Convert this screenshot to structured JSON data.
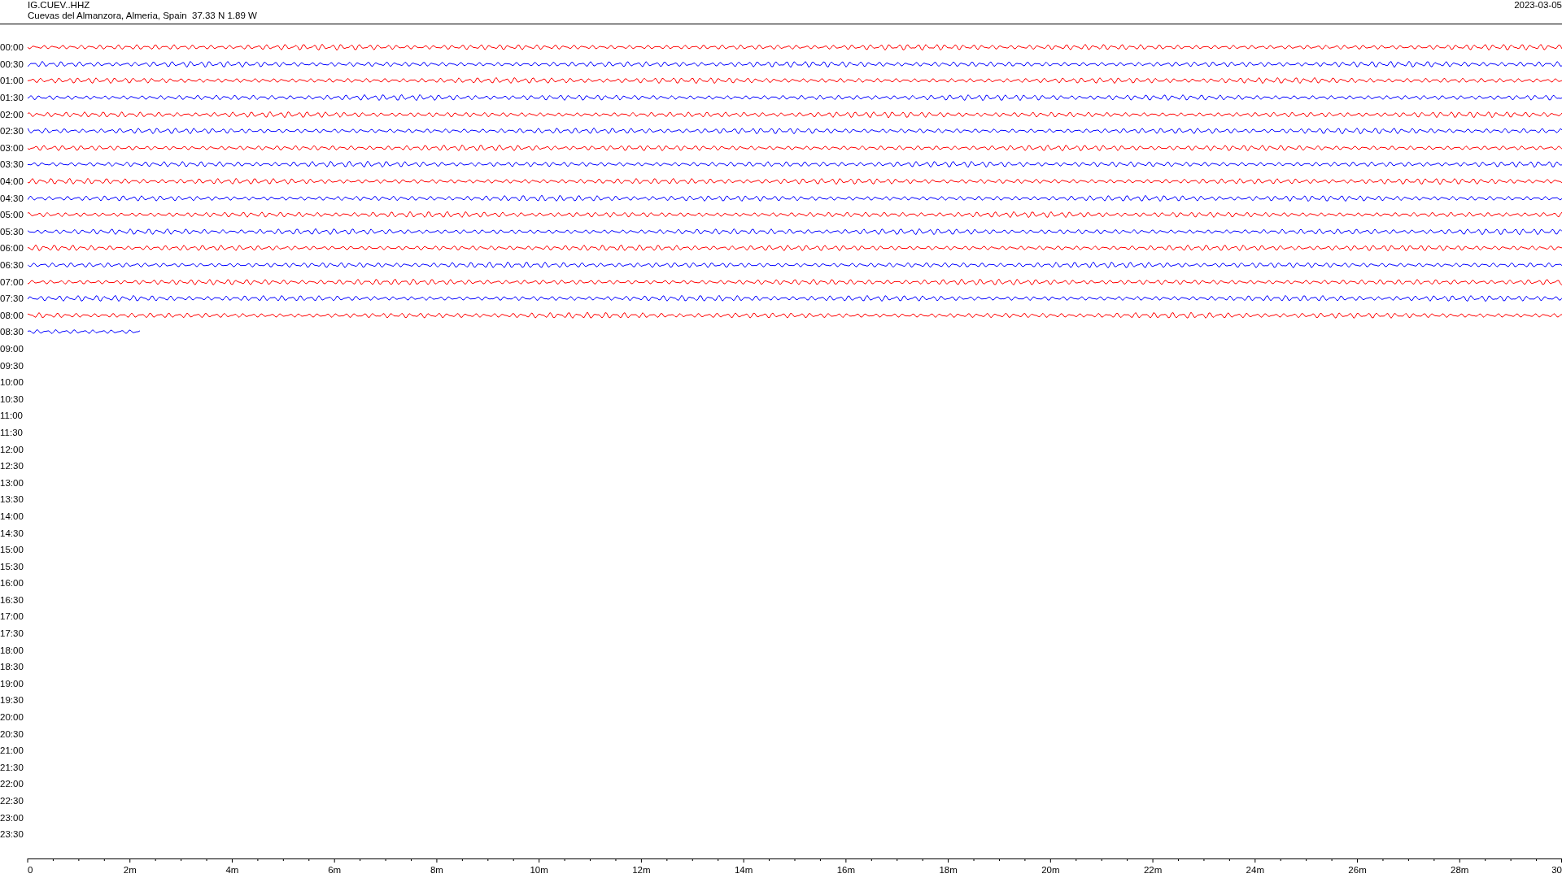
{
  "header": {
    "station": "IG.CUEV..HHZ",
    "location": "Cuevas del Almanzora, Almeria, Spain  37.33 N 1.89 W",
    "date": "2023-03-05"
  },
  "rows": [
    {
      "time": "00:00",
      "kind": "full",
      "color": "#ff0000"
    },
    {
      "time": "00:30",
      "kind": "full",
      "color": "#0000ff"
    },
    {
      "time": "01:00",
      "kind": "full",
      "color": "#ff0000"
    },
    {
      "time": "01:30",
      "kind": "full",
      "color": "#0000ff"
    },
    {
      "time": "02:00",
      "kind": "full",
      "color": "#ff0000"
    },
    {
      "time": "02:30",
      "kind": "full",
      "color": "#0000ff"
    },
    {
      "time": "03:00",
      "kind": "full",
      "color": "#ff0000"
    },
    {
      "time": "03:30",
      "kind": "full",
      "color": "#0000ff"
    },
    {
      "time": "04:00",
      "kind": "full",
      "color": "#ff0000"
    },
    {
      "time": "04:30",
      "kind": "full",
      "color": "#0000ff"
    },
    {
      "time": "05:00",
      "kind": "full",
      "color": "#ff0000"
    },
    {
      "time": "05:30",
      "kind": "full",
      "color": "#0000ff"
    },
    {
      "time": "06:00",
      "kind": "full",
      "color": "#ff0000"
    },
    {
      "time": "06:30",
      "kind": "full",
      "color": "#0000ff"
    },
    {
      "time": "07:00",
      "kind": "full",
      "color": "#ff0000"
    },
    {
      "time": "07:30",
      "kind": "full",
      "color": "#0000ff"
    },
    {
      "time": "08:00",
      "kind": "full",
      "color": "#ff0000"
    },
    {
      "time": "08:30",
      "kind": "partial",
      "color": "#0000ff"
    },
    {
      "time": "09:00",
      "kind": "empty"
    },
    {
      "time": "09:30",
      "kind": "empty"
    },
    {
      "time": "10:00",
      "kind": "empty"
    },
    {
      "time": "10:30",
      "kind": "empty"
    },
    {
      "time": "11:00",
      "kind": "empty"
    },
    {
      "time": "11:30",
      "kind": "empty"
    },
    {
      "time": "12:00",
      "kind": "empty"
    },
    {
      "time": "12:30",
      "kind": "empty"
    },
    {
      "time": "13:00",
      "kind": "empty"
    },
    {
      "time": "13:30",
      "kind": "empty"
    },
    {
      "time": "14:00",
      "kind": "empty"
    },
    {
      "time": "14:30",
      "kind": "empty"
    },
    {
      "time": "15:00",
      "kind": "empty"
    },
    {
      "time": "15:30",
      "kind": "empty"
    },
    {
      "time": "16:00",
      "kind": "empty"
    },
    {
      "time": "16:30",
      "kind": "empty"
    },
    {
      "time": "17:00",
      "kind": "empty"
    },
    {
      "time": "17:30",
      "kind": "empty"
    },
    {
      "time": "18:00",
      "kind": "empty"
    },
    {
      "time": "18:30",
      "kind": "empty"
    },
    {
      "time": "19:00",
      "kind": "empty"
    },
    {
      "time": "19:30",
      "kind": "empty"
    },
    {
      "time": "20:00",
      "kind": "empty"
    },
    {
      "time": "20:30",
      "kind": "empty"
    },
    {
      "time": "21:00",
      "kind": "empty"
    },
    {
      "time": "21:30",
      "kind": "empty"
    },
    {
      "time": "22:00",
      "kind": "empty"
    },
    {
      "time": "22:30",
      "kind": "empty"
    },
    {
      "time": "23:00",
      "kind": "empty"
    },
    {
      "time": "23:30",
      "kind": "empty"
    }
  ],
  "axis": {
    "labels": [
      "0",
      "2m",
      "4m",
      "6m",
      "8m",
      "10m",
      "12m",
      "14m",
      "16m",
      "18m",
      "20m",
      "22m",
      "24m",
      "26m",
      "28m",
      "30"
    ]
  }
}
